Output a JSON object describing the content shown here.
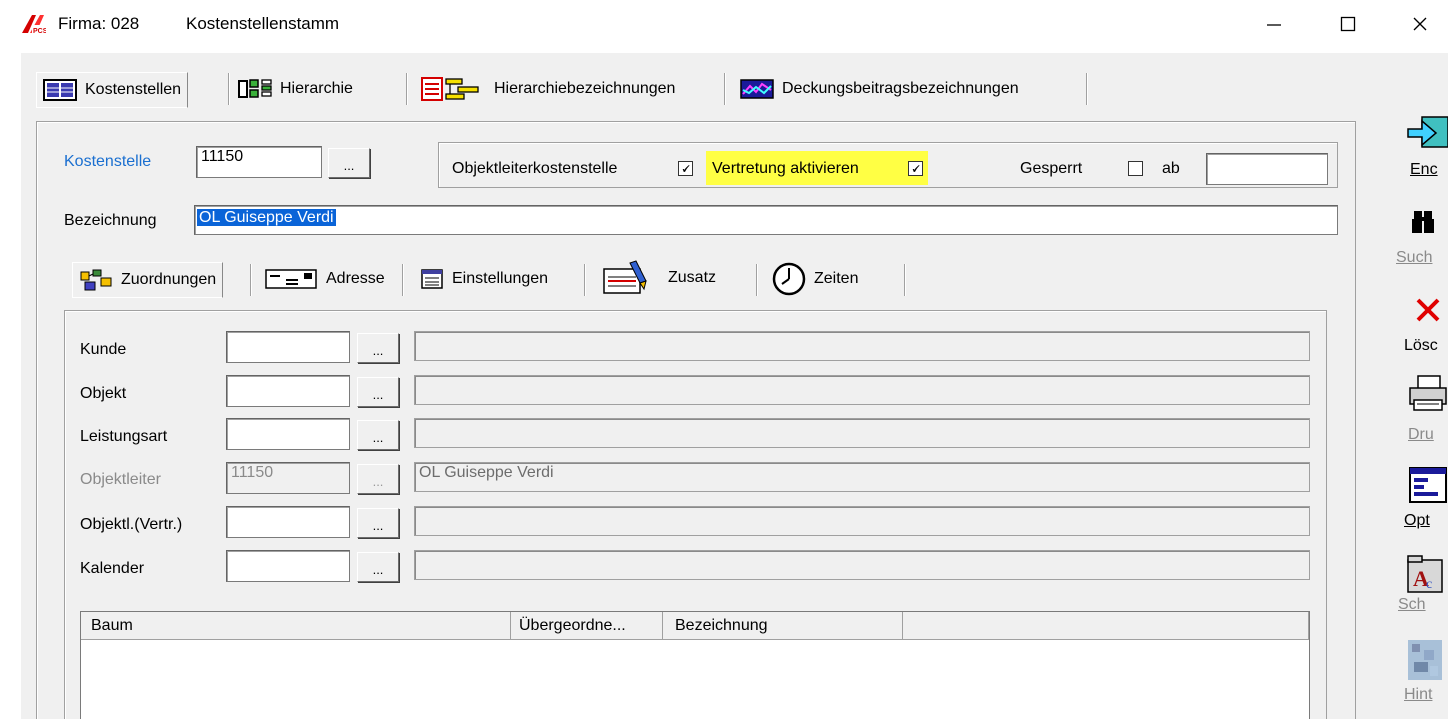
{
  "window": {
    "title_company": "Firma: 028",
    "title_module": "Kostenstellenstamm",
    "minimize_glyph": "—",
    "maximize_glyph": "☐",
    "close_glyph": "✕"
  },
  "main_tabs": [
    {
      "label": "Kostenstellen",
      "icon": "list-table-icon"
    },
    {
      "label": "Hierarchie",
      "icon": "hierarchy-icon"
    },
    {
      "label": "Hierarchiebezeichnungen",
      "icon": "hierarchy-labels-icon"
    },
    {
      "label": "Deckungsbeitragsbezeichnungen",
      "icon": "chart-icon"
    }
  ],
  "header": {
    "kostenstelle_label": "Kostenstelle",
    "kostenstelle_value": "11150",
    "dots": "...",
    "objektleiter_label": "Objektleiterkostenstelle",
    "objektleiter_checked": "🗸",
    "vertretung_label": "Vertretung aktivieren",
    "vertretung_checked": "🗸",
    "gesperrt_label": "Gesperrt",
    "ab_label": "ab",
    "ab_value": "",
    "bezeichnung_label": "Bezeichnung",
    "bezeichnung_value": "OL Guiseppe Verdi",
    "highlight_color": "#ffff44",
    "link_color": "#1a6fd0"
  },
  "sub_tabs": [
    {
      "label": "Zuordnungen",
      "icon": "assignments-icon"
    },
    {
      "label": "Adresse",
      "icon": "address-card-icon"
    },
    {
      "label": "Einstellungen",
      "icon": "settings-window-icon"
    },
    {
      "label": "Zusatz",
      "icon": "edit-document-icon"
    },
    {
      "label": "Zeiten",
      "icon": "clock-icon"
    }
  ],
  "fields": [
    {
      "label": "Kunde",
      "code": "",
      "desc": "",
      "disabled": false
    },
    {
      "label": "Objekt",
      "code": "",
      "desc": "",
      "disabled": false
    },
    {
      "label": "Leistungsart",
      "code": "",
      "desc": "",
      "disabled": false
    },
    {
      "label": "Objektleiter",
      "code": "11150",
      "desc": "OL Guiseppe Verdi",
      "disabled": true
    },
    {
      "label": "Objektl.(Vertr.)",
      "code": "",
      "desc": "",
      "disabled": false
    },
    {
      "label": "Kalender",
      "code": "",
      "desc": "",
      "disabled": false
    }
  ],
  "tree_list": {
    "columns": [
      "Baum",
      "Übergeordne...",
      "Bezeichnung",
      ""
    ]
  },
  "toolbar": [
    {
      "label": "Enc",
      "icon": "exit-arrow-icon",
      "disabled": false
    },
    {
      "label": "Such",
      "icon": "binoculars-icon",
      "disabled": true
    },
    {
      "label": "Lösc",
      "icon": "delete-x-icon",
      "disabled": false
    },
    {
      "label": "Dru",
      "icon": "printer-icon",
      "disabled": true
    },
    {
      "label": "Opt",
      "icon": "options-window-icon",
      "disabled": false
    },
    {
      "label": "Sch",
      "icon": "font-folder-icon",
      "disabled": true
    },
    {
      "label": "Hint",
      "icon": "background-image-icon",
      "disabled": true
    }
  ]
}
